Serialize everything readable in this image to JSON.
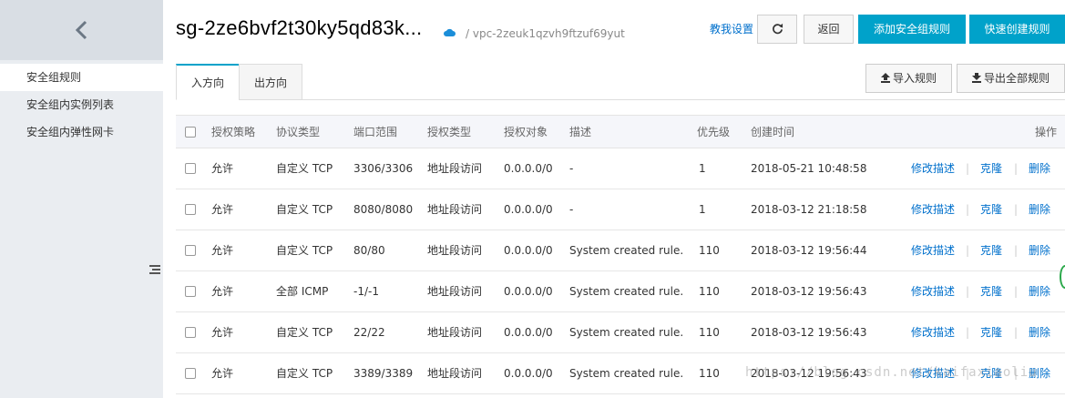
{
  "sidebar": {
    "items": [
      {
        "label": "安全组规则",
        "active": true
      },
      {
        "label": "安全组内实例列表",
        "active": false
      },
      {
        "label": "安全组内弹性网卡",
        "active": false
      }
    ]
  },
  "header": {
    "title": "sg-2ze6bvf2t30ky5qd83k...",
    "vpc": "/ vpc-2zeuk1qzvh9ftzuf69yut",
    "teach_link": "教我设置",
    "back_label": "返回",
    "add_rule_label": "添加安全组规则",
    "quick_create_label": "快速创建规则"
  },
  "tabs": [
    {
      "label": "入方向",
      "active": true
    },
    {
      "label": "出方向",
      "active": false
    }
  ],
  "toolbar": {
    "import_label": "导入规则",
    "export_label": "导出全部规则"
  },
  "table": {
    "columns": [
      "授权策略",
      "协议类型",
      "端口范围",
      "授权类型",
      "授权对象",
      "描述",
      "优先级",
      "创建时间",
      "操作"
    ],
    "rows": [
      {
        "policy": "允许",
        "protocol": "自定义 TCP",
        "port": "3306/3306",
        "auth_type": "地址段访问",
        "auth_object": "0.0.0.0/0",
        "desc": "-",
        "priority": "1",
        "created": "2018-05-21 10:48:58"
      },
      {
        "policy": "允许",
        "protocol": "自定义 TCP",
        "port": "8080/8080",
        "auth_type": "地址段访问",
        "auth_object": "0.0.0.0/0",
        "desc": "-",
        "priority": "1",
        "created": "2018-03-12 21:18:58"
      },
      {
        "policy": "允许",
        "protocol": "自定义 TCP",
        "port": "80/80",
        "auth_type": "地址段访问",
        "auth_object": "0.0.0.0/0",
        "desc": "System created rule.",
        "priority": "110",
        "created": "2018-03-12 19:56:44"
      },
      {
        "policy": "允许",
        "protocol": "全部 ICMP",
        "port": "-1/-1",
        "auth_type": "地址段访问",
        "auth_object": "0.0.0.0/0",
        "desc": "System created rule.",
        "priority": "110",
        "created": "2018-03-12 19:56:43"
      },
      {
        "policy": "允许",
        "protocol": "自定义 TCP",
        "port": "22/22",
        "auth_type": "地址段访问",
        "auth_object": "0.0.0.0/0",
        "desc": "System created rule.",
        "priority": "110",
        "created": "2018-03-12 19:56:43"
      },
      {
        "policy": "允许",
        "protocol": "自定义 TCP",
        "port": "3389/3389",
        "auth_type": "地址段访问",
        "auth_object": "0.0.0.0/0",
        "desc": "System created rule.",
        "priority": "110",
        "created": "2018-03-12 19:56:43"
      }
    ],
    "actions": {
      "edit": "修改描述",
      "clone": "克隆",
      "delete": "删除",
      "separator": "|"
    }
  },
  "watermark": "https://blog.csdn.net/kaifaxiaoliu",
  "colors": {
    "accent": "#00a2ca",
    "link": "#0070cc"
  }
}
